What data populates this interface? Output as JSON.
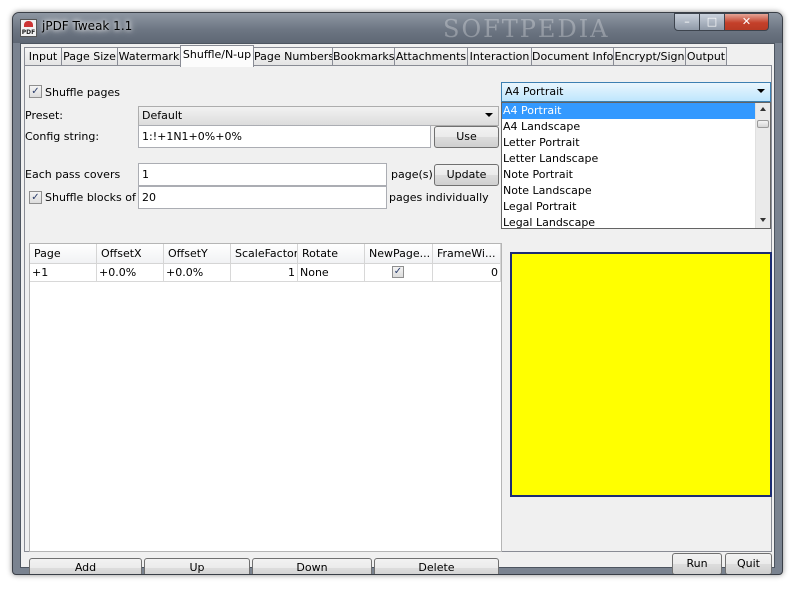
{
  "window": {
    "title": "jPDF Tweak 1.1",
    "watermark": "SOFTPEDIA"
  },
  "tabs": [
    {
      "label": "Input"
    },
    {
      "label": "Page Size"
    },
    {
      "label": "Watermark"
    },
    {
      "label": "Shuffle/N-up"
    },
    {
      "label": "Page Numbers"
    },
    {
      "label": "Bookmarks"
    },
    {
      "label": "Attachments"
    },
    {
      "label": "Interaction"
    },
    {
      "label": "Document Info"
    },
    {
      "label": "Encrypt/Sign"
    },
    {
      "label": "Output"
    }
  ],
  "active_tab": "Shuffle/N-up",
  "shuffle": {
    "shuffle_pages_label": "Shuffle pages",
    "shuffle_pages_checked": true,
    "preset_label": "Preset:",
    "preset_value": "Default",
    "config_label": "Config string:",
    "config_value": "1:!+1N1+0%+0%",
    "use_button": "Use",
    "each_pass_label": "Each pass covers",
    "each_pass_value": "1",
    "pages_unit": "page(s)",
    "update_button": "Update",
    "shuffle_blocks_label": "Shuffle blocks of",
    "shuffle_blocks_checked": true,
    "shuffle_blocks_value": "20",
    "pages_individually": "pages individually"
  },
  "table": {
    "columns": [
      "Page",
      "OffsetX",
      "OffsetY",
      "ScaleFactor",
      "Rotate",
      "NewPage...",
      "FrameWi..."
    ],
    "rows": [
      {
        "page": "+1",
        "offsetx": "+0.0%",
        "offsety": "+0.0%",
        "scale": "1",
        "rotate": "None",
        "newpage": true,
        "frame": "0"
      }
    ]
  },
  "table_buttons": {
    "add": "Add",
    "up": "Up",
    "down": "Down",
    "delete": "Delete"
  },
  "page_format": {
    "selected": "A4 Portrait",
    "options": [
      "A4 Portrait",
      "A4 Landscape",
      "Letter Portrait",
      "Letter Landscape",
      "Note Portrait",
      "Note Landscape",
      "Legal Portrait",
      "Legal Landscape"
    ],
    "highlighted_index": 0,
    "preview_color": "#ffff00"
  },
  "footer": {
    "run": "Run",
    "quit": "Quit"
  }
}
